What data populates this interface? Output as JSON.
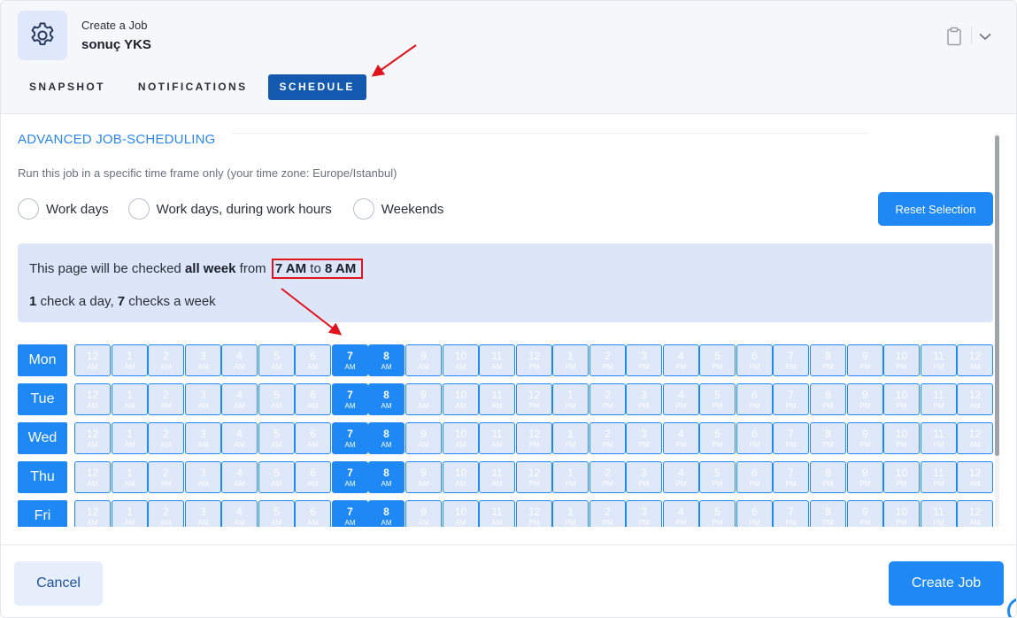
{
  "header": {
    "caption": "Create a Job",
    "job_name": "sonuç YKS",
    "icons": [
      "gear-icon",
      "clipboard-icon",
      "chevron-down-icon"
    ],
    "tabs": [
      {
        "label": "SNAPSHOT",
        "active": false
      },
      {
        "label": "NOTIFICATIONS",
        "active": false
      },
      {
        "label": "SCHEDULE",
        "active": true
      }
    ]
  },
  "schedule": {
    "title": "ADVANCED JOB-SCHEDULING",
    "timezone_text": "Run this job in a specific time frame only (your time zone: Europe/Istanbul)",
    "presets": [
      "Work days",
      "Work days, during work hours",
      "Weekends"
    ],
    "reset_label": "Reset Selection",
    "summary": {
      "prefix": "This page will be checked ",
      "range": "all week",
      "from_word": " from ",
      "start": "7 AM",
      "to_word": " to ",
      "end": "8 AM",
      "day_count": "1",
      "day_text": " check a day, ",
      "week_count": "7",
      "week_text": " checks a week"
    },
    "hours": [
      {
        "h": "12",
        "m": "AM"
      },
      {
        "h": "1",
        "m": "AM"
      },
      {
        "h": "2",
        "m": "AM"
      },
      {
        "h": "3",
        "m": "AM"
      },
      {
        "h": "4",
        "m": "AM"
      },
      {
        "h": "5",
        "m": "AM"
      },
      {
        "h": "6",
        "m": "AM"
      },
      {
        "h": "7",
        "m": "AM"
      },
      {
        "h": "8",
        "m": "AM"
      },
      {
        "h": "9",
        "m": "AM"
      },
      {
        "h": "10",
        "m": "AM"
      },
      {
        "h": "11",
        "m": "AM"
      },
      {
        "h": "12",
        "m": "PM"
      },
      {
        "h": "1",
        "m": "PM"
      },
      {
        "h": "2",
        "m": "PM"
      },
      {
        "h": "3",
        "m": "PM"
      },
      {
        "h": "4",
        "m": "PM"
      },
      {
        "h": "5",
        "m": "PM"
      },
      {
        "h": "6",
        "m": "PM"
      },
      {
        "h": "7",
        "m": "PM"
      },
      {
        "h": "8",
        "m": "PM"
      },
      {
        "h": "9",
        "m": "PM"
      },
      {
        "h": "10",
        "m": "PM"
      },
      {
        "h": "11",
        "m": "PM"
      },
      {
        "h": "12",
        "m": "AM"
      }
    ],
    "days": [
      "Mon",
      "Tue",
      "Wed",
      "Thu",
      "Fri"
    ],
    "selected_hour_indices": [
      7,
      8
    ]
  },
  "footer": {
    "cancel_label": "Cancel",
    "create_label": "Create Job"
  },
  "colors": {
    "accent": "#1e88f5",
    "active_tab": "#1459b0",
    "info_bg": "#dce6f8",
    "annotation": "#e0141c"
  }
}
